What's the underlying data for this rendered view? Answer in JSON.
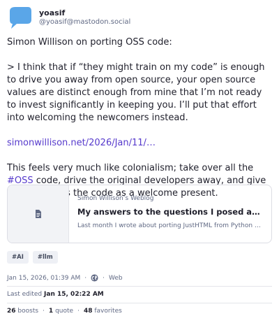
{
  "author": {
    "display_name": "yoasif",
    "handle": "@yoasif@mastodon.social",
    "avatar_icon": "speech-bubble-avatar",
    "avatar_color": "#5aa6e8"
  },
  "post": {
    "line1": "Simon Willison on porting OSS code:",
    "quote": "> I think that if “they might train on my code” is enough to drive you away from open source, your open source values are distinct enough from mine that I’m not ready to invest significantly in keeping you. I’ll put that effort into welcoming the newcomers instead.",
    "link_text": "simonwillison.net/2026/Jan/11/…",
    "para_before_tag": "This feels very much like colonialism; take over all the ",
    "hashtag": "#OSS",
    "para_after_tag": " code, drive the original developers away, and give the colonizers the code as a welcome present."
  },
  "card": {
    "site": "Simon Willison’s Weblog",
    "title": "My answers to the questions I posed about por…",
    "description": "Last month I wrote about porting JustHTML from Python to Java…",
    "thumb_icon": "document-icon"
  },
  "tags": [
    "#AI",
    "#llm"
  ],
  "meta": {
    "timestamp": "Jan 15, 2026, 01:39 AM",
    "sep": "·",
    "visibility_icon": "globe-icon",
    "app": "Web"
  },
  "edited": {
    "label": "Last edited",
    "date": "Jan 15, 02:22 AM"
  },
  "stats": {
    "boosts_count": "26",
    "boosts_label": "boosts",
    "quotes_count": "1",
    "quotes_label": "quote",
    "favorites_count": "48",
    "favorites_label": "favorites",
    "sep": "·"
  },
  "colors": {
    "accent": "#563acc",
    "muted": "#606984",
    "text": "#1f1f2b"
  }
}
